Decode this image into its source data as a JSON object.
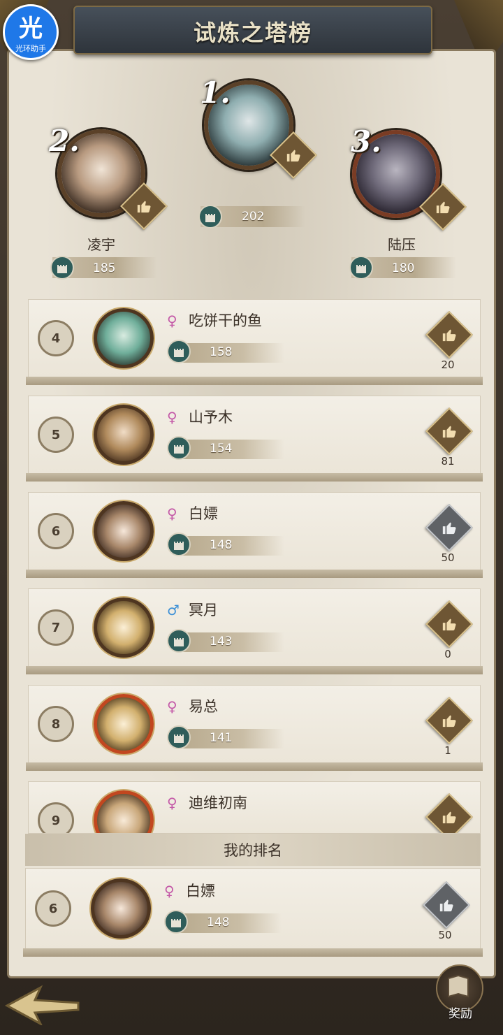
{
  "app": {
    "title": "试炼之塔榜"
  },
  "helper": {
    "char": "光",
    "name": "光环助手"
  },
  "podium": [
    {
      "rank": "1.",
      "name": "",
      "score": "202",
      "like_active": false
    },
    {
      "rank": "2.",
      "name": "凌宇",
      "score": "185",
      "like_active": false
    },
    {
      "rank": "3.",
      "name": "陆压",
      "score": "180",
      "like_active": false
    }
  ],
  "list": [
    {
      "rank": "4",
      "gender": "♀",
      "name": "吃饼干的鱼",
      "score": "158",
      "likes": "20",
      "liked": false
    },
    {
      "rank": "5",
      "gender": "♀",
      "name": "山予木",
      "score": "154",
      "likes": "81",
      "liked": false
    },
    {
      "rank": "6",
      "gender": "♀",
      "name": "白嫖",
      "score": "148",
      "likes": "50",
      "liked": true
    },
    {
      "rank": "7",
      "gender": "♂",
      "name": "冥月",
      "score": "143",
      "likes": "0",
      "liked": false
    },
    {
      "rank": "8",
      "gender": "♀",
      "name": "易总",
      "score": "141",
      "likes": "1",
      "liked": false
    },
    {
      "rank": "9",
      "gender": "♀",
      "name": "迪维初南",
      "score": "",
      "likes": "",
      "liked": false
    }
  ],
  "my_rank": {
    "header": "我的排名",
    "rank": "6",
    "gender": "♀",
    "name": "白嫖",
    "score": "148",
    "likes": "50",
    "liked": true
  },
  "footer": {
    "reward_label": "奖励"
  },
  "icons": {
    "tower": "tower-icon",
    "like": "thumbs-up-icon",
    "back": "back-arrow-icon",
    "reward": "reward-map-icon"
  },
  "colors": {
    "accent": "#6e5634",
    "female": "#c45aa8",
    "male": "#3b8fd6",
    "tower_badge": "#2f5d5a"
  }
}
